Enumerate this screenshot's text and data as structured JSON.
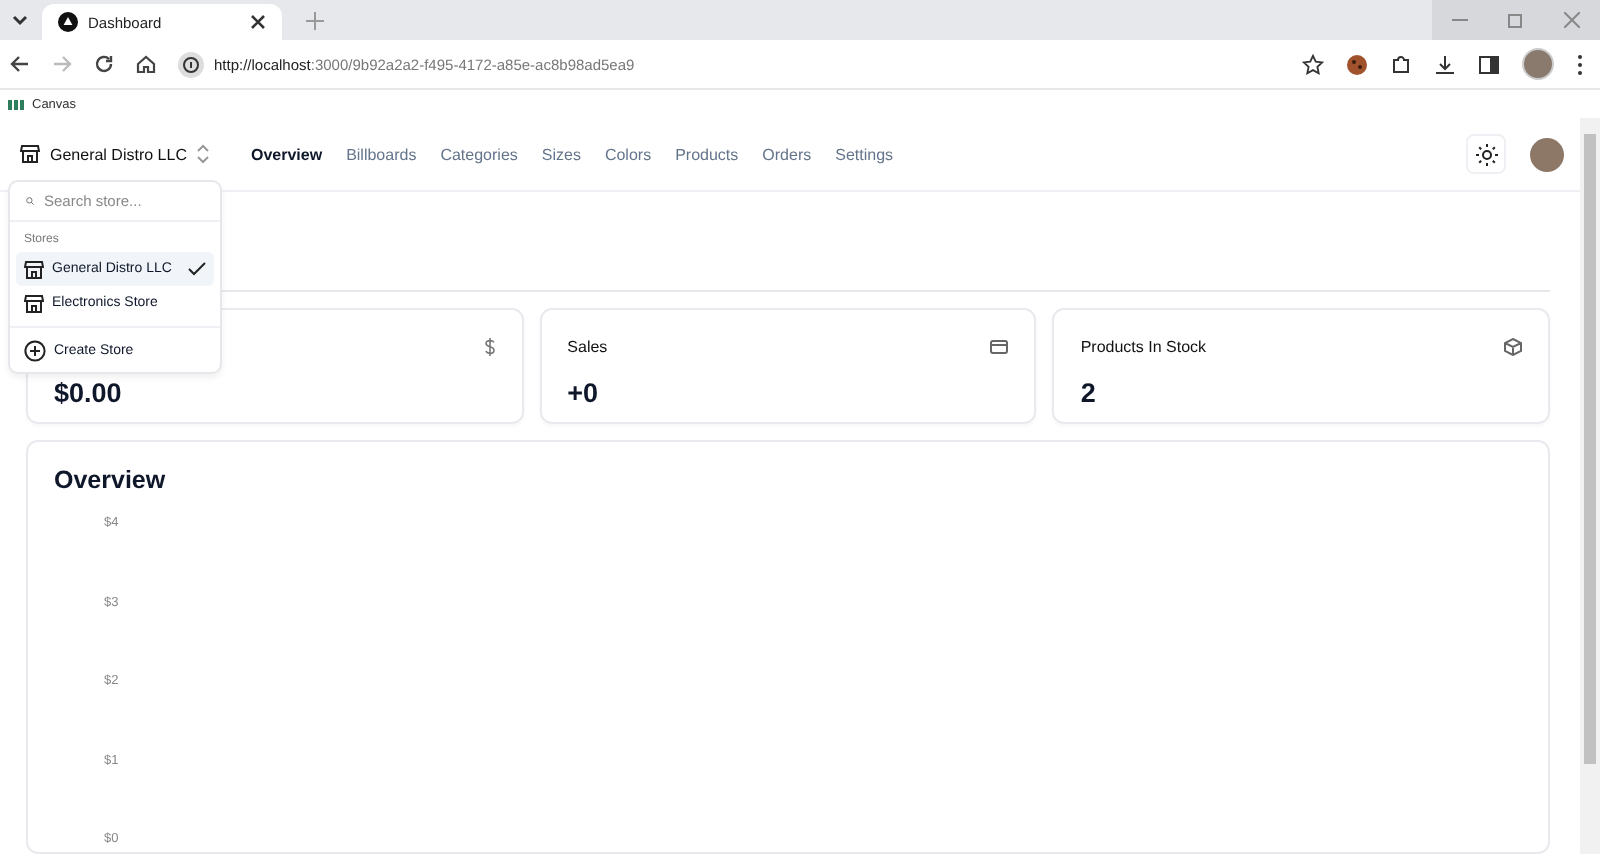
{
  "browser": {
    "tab": {
      "title": "Dashboard"
    },
    "url_host": "http://localhost",
    "url_rest": ":3000/9b92a2a2-f495-4172-a85e-ac8b98ad5ea9",
    "bookmarks": [
      {
        "label": "Canvas"
      }
    ]
  },
  "store_switcher": {
    "label": "General Distro LLC"
  },
  "nav": [
    {
      "label": "Overview",
      "selected": true
    },
    {
      "label": "Billboards",
      "selected": false
    },
    {
      "label": "Categories",
      "selected": false
    },
    {
      "label": "Sizes",
      "selected": false
    },
    {
      "label": "Colors",
      "selected": false
    },
    {
      "label": "Products",
      "selected": false
    },
    {
      "label": "Orders",
      "selected": false
    },
    {
      "label": "Settings",
      "selected": false
    }
  ],
  "store_menu": {
    "search": {
      "placeholder": "Search store..."
    },
    "group_label": "Stores",
    "stores": [
      {
        "label": "General Distro LLC",
        "selected": true
      },
      {
        "label": "Electronics Store",
        "selected": false
      }
    ],
    "create_label": "Create Store"
  },
  "stats": [
    {
      "kind": "dollar",
      "value": "$0.00"
    },
    {
      "kind": "card",
      "title": "Sales",
      "value": "+0"
    },
    {
      "kind": "package",
      "title": "Products In Stock",
      "value": "2"
    }
  ],
  "overview": {
    "title": "Overview",
    "y_labels": [
      "$4",
      "$3",
      "$2",
      "$1",
      "$0"
    ]
  }
}
